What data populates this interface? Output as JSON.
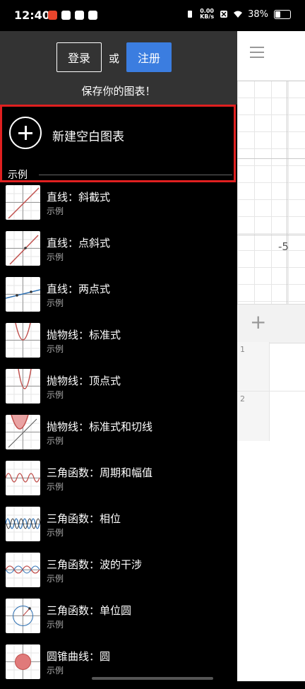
{
  "status_bar": {
    "time": "12:40",
    "speed_value": "0.00",
    "speed_unit": "KB/s",
    "battery": "38%"
  },
  "drawer": {
    "login_label": "登录",
    "or_label": "或",
    "signup_label": "注册",
    "save_prompt": "保存你的图表！",
    "new_graph_label": "新建空白图表",
    "examples_heading": "示例",
    "items": [
      {
        "title": "直线：斜截式",
        "subtitle": "示例",
        "icon": "line-slope-thumb"
      },
      {
        "title": "直线：点斜式",
        "subtitle": "示例",
        "icon": "line-point-thumb"
      },
      {
        "title": "直线：两点式",
        "subtitle": "示例",
        "icon": "line-two-point-thumb"
      },
      {
        "title": "抛物线：标准式",
        "subtitle": "示例",
        "icon": "parabola-standard-thumb"
      },
      {
        "title": "抛物线：顶点式",
        "subtitle": "示例",
        "icon": "parabola-vertex-thumb"
      },
      {
        "title": "抛物线：标准式和切线",
        "subtitle": "示例",
        "icon": "parabola-tangent-thumb"
      },
      {
        "title": "三角函数：周期和幅值",
        "subtitle": "示例",
        "icon": "trig-period-thumb"
      },
      {
        "title": "三角函数：相位",
        "subtitle": "示例",
        "icon": "trig-phase-thumb"
      },
      {
        "title": "三角函数：波的干涉",
        "subtitle": "示例",
        "icon": "trig-interference-thumb"
      },
      {
        "title": "三角函数：单位圆",
        "subtitle": "示例",
        "icon": "trig-unit-circle-thumb"
      },
      {
        "title": "圆锥曲线：圆",
        "subtitle": "示例",
        "icon": "conic-circle-thumb"
      }
    ]
  },
  "calculator": {
    "axis_label": "-5",
    "expression_rows": [
      "1",
      "2"
    ]
  },
  "colors": {
    "accent_blue": "#3b7de0",
    "highlight_red": "#e02020",
    "curve_red": "#c0504d",
    "curve_blue": "#2d70b3"
  }
}
